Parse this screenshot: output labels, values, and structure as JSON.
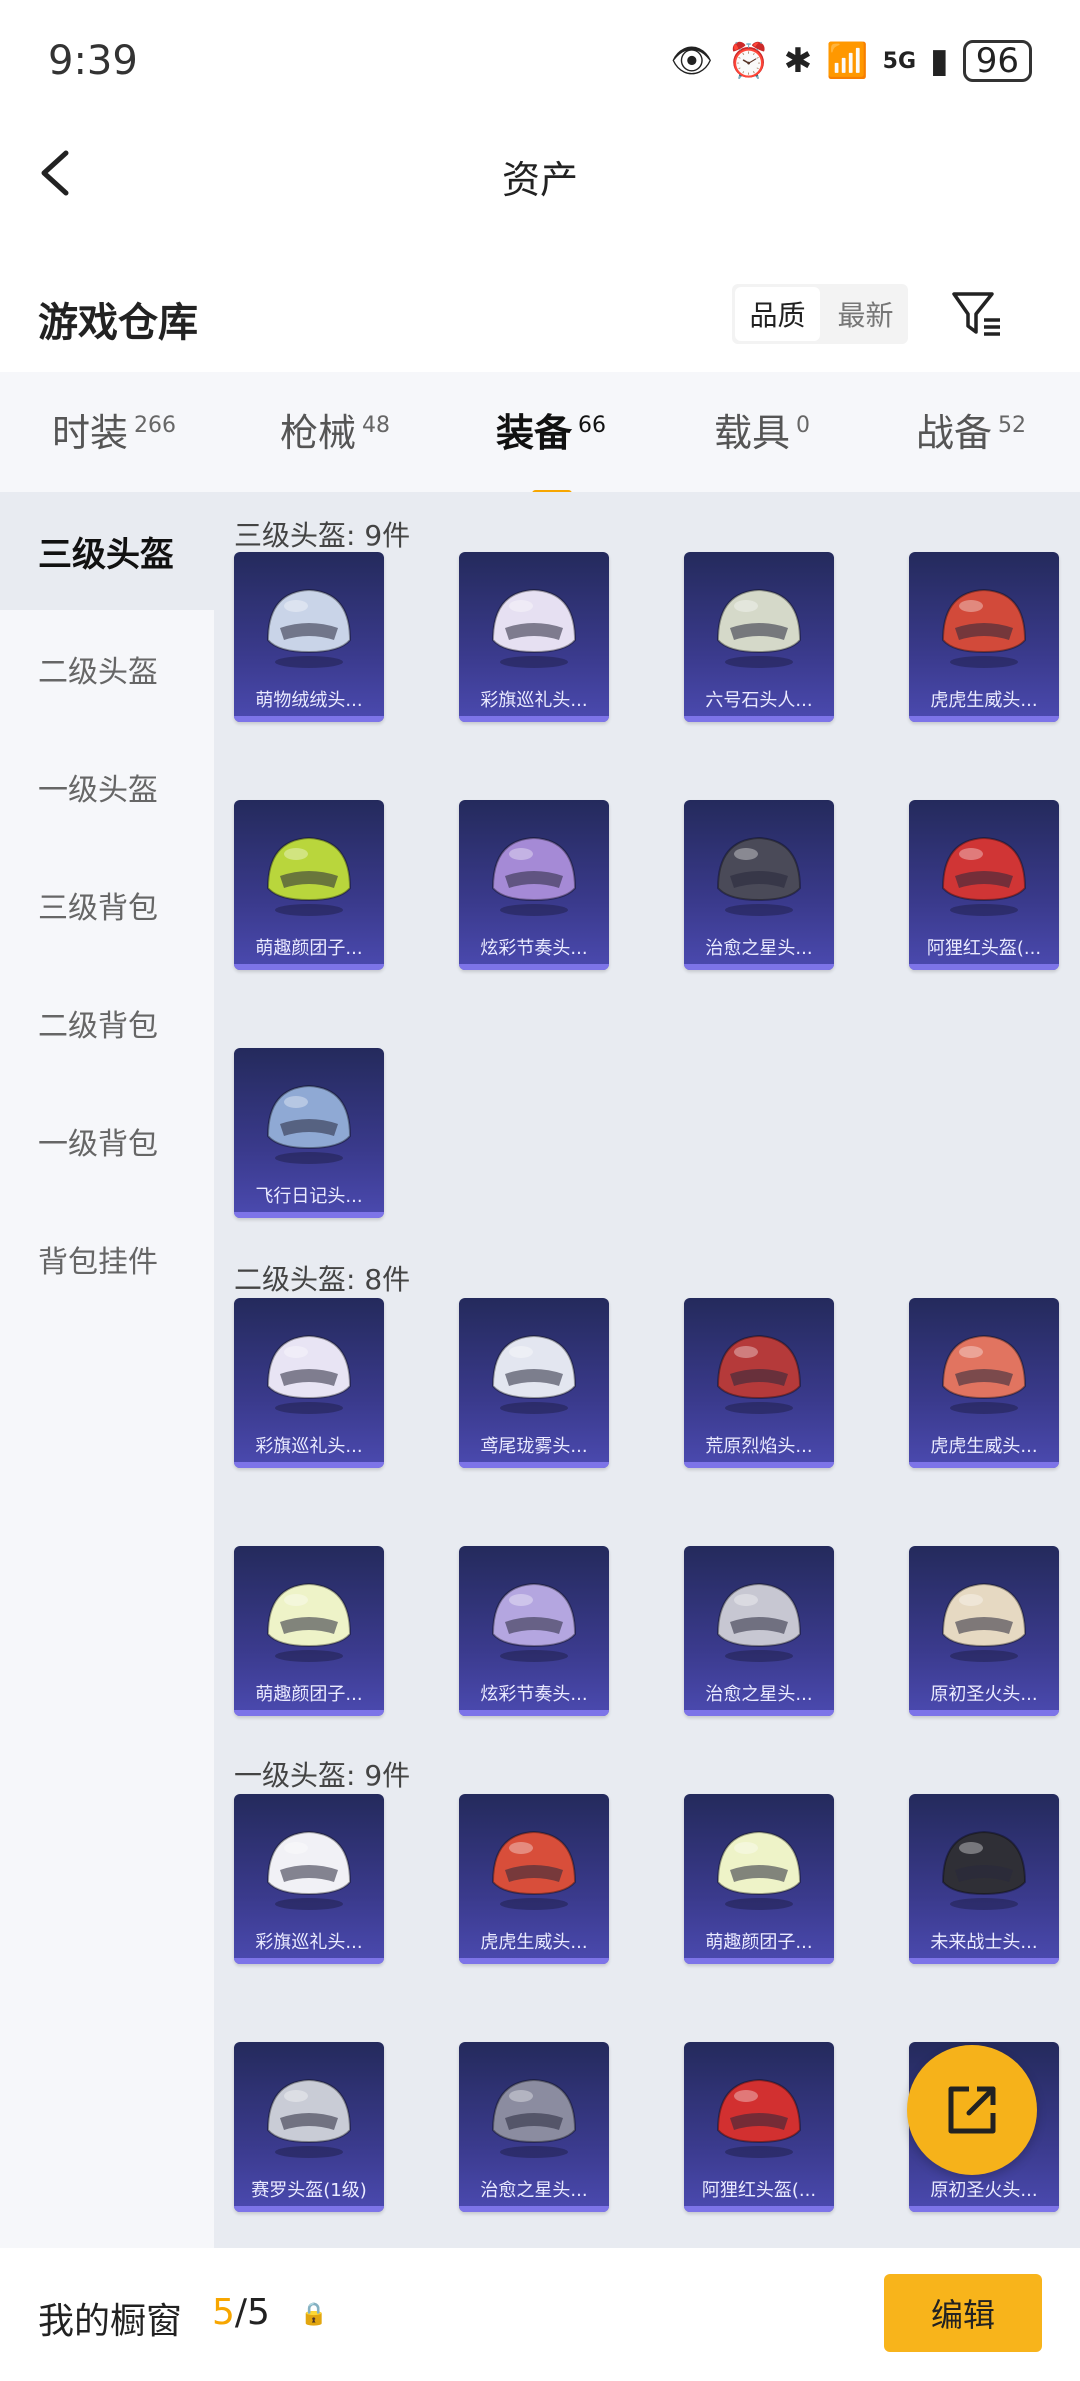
{
  "status_bar": {
    "time": "9:39",
    "network": "5G",
    "battery": "96"
  },
  "header": {
    "title": "资产"
  },
  "section": {
    "title": "游戏仓库",
    "sort_quality": "品质",
    "sort_latest": "最新"
  },
  "tabs": [
    {
      "label": "时装",
      "count": "266"
    },
    {
      "label": "枪械",
      "count": "48"
    },
    {
      "label": "装备",
      "count": "66"
    },
    {
      "label": "载具",
      "count": "0"
    },
    {
      "label": "战备",
      "count": "52"
    }
  ],
  "sidebar": [
    {
      "label": "三级头盔"
    },
    {
      "label": "二级头盔"
    },
    {
      "label": "一级头盔"
    },
    {
      "label": "三级背包"
    },
    {
      "label": "二级背包"
    },
    {
      "label": "一级背包"
    },
    {
      "label": "背包挂件"
    }
  ],
  "groups": [
    {
      "title": "三级头盔: 9件",
      "items": [
        {
          "name": "萌物绒绒头...",
          "color": "#c9d4e8"
        },
        {
          "name": "彩旗巡礼头...",
          "color": "#e6e0f2"
        },
        {
          "name": "六号石头人...",
          "color": "#d5d9c9"
        },
        {
          "name": "虎虎生威头...",
          "color": "#d24a3a"
        },
        {
          "name": "萌趣颜团子...",
          "color": "#b9d63c"
        },
        {
          "name": "炫彩节奏头...",
          "color": "#a58ad6"
        },
        {
          "name": "治愈之星头...",
          "color": "#4a4a58"
        },
        {
          "name": "阿狸红头盔(...",
          "color": "#d03535"
        },
        {
          "name": "飞行日记头...",
          "color": "#8fa9d4"
        }
      ]
    },
    {
      "title": "二级头盔: 8件",
      "items": [
        {
          "name": "彩旗巡礼头...",
          "color": "#e8e4f4"
        },
        {
          "name": "鸢尾珑雾头...",
          "color": "#e3e6f0"
        },
        {
          "name": "荒原烈焰头...",
          "color": "#b53a3a"
        },
        {
          "name": "虎虎生威头...",
          "color": "#e17460"
        },
        {
          "name": "萌趣颜团子...",
          "color": "#eef3c8"
        },
        {
          "name": "炫彩节奏头...",
          "color": "#b4a6e0"
        },
        {
          "name": "治愈之星头...",
          "color": "#c7c7d2"
        },
        {
          "name": "原初圣火头...",
          "color": "#e6d9c2"
        }
      ]
    },
    {
      "title": "一级头盔: 9件",
      "items": [
        {
          "name": "彩旗巡礼头...",
          "color": "#f1f1f6"
        },
        {
          "name": "虎虎生威头...",
          "color": "#d84e3a"
        },
        {
          "name": "萌趣颜团子...",
          "color": "#eef3c8"
        },
        {
          "name": "未来战士头...",
          "color": "#2f2f36"
        },
        {
          "name": "赛罗头盔(1级)",
          "color": "#c9ccd6"
        },
        {
          "name": "治愈之星头...",
          "color": "#8b8ca0"
        },
        {
          "name": "阿狸红头盔(...",
          "color": "#d23030"
        },
        {
          "name": "原初圣火头...",
          "color": "#d9c8a8"
        }
      ]
    }
  ],
  "bottom": {
    "label": "我的橱窗",
    "count_used": "5",
    "count_sep": "/",
    "count_total": "5",
    "edit": "编辑"
  }
}
